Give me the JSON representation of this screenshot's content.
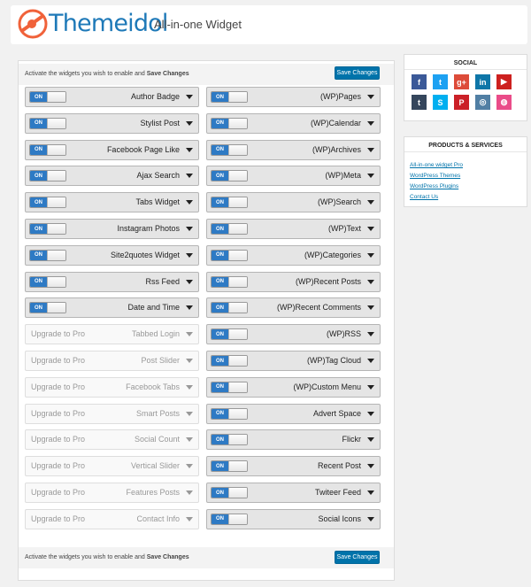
{
  "header": {
    "brand": "Themeidol",
    "subtitle": "All-in-one Widget"
  },
  "bar": {
    "instruction_prefix": "Activate the widgets you wish to enable and ",
    "instruction_bold": "Save Changes",
    "save_label": "Save Changes"
  },
  "toggle_label": "ON",
  "left_widgets": [
    {
      "label": "Author Badge",
      "active": true
    },
    {
      "label": "Stylist Post",
      "active": true
    },
    {
      "label": "Facebook Page Like",
      "active": true
    },
    {
      "label": "Ajax Search",
      "active": true
    },
    {
      "label": "Tabs Widget",
      "active": true
    },
    {
      "label": "Instagram Photos",
      "active": true
    },
    {
      "label": "Site2quotes Widget",
      "active": true
    },
    {
      "label": "Rss Feed",
      "active": true
    },
    {
      "label": "Date and Time",
      "active": true
    },
    {
      "label": "Tabbed Login",
      "active": false,
      "pro": "Upgrade to Pro"
    },
    {
      "label": "Post Slider",
      "active": false,
      "pro": "Upgrade to Pro"
    },
    {
      "label": "Facebook Tabs",
      "active": false,
      "pro": "Upgrade to Pro"
    },
    {
      "label": "Smart Posts",
      "active": false,
      "pro": "Upgrade to Pro"
    },
    {
      "label": "Social Count",
      "active": false,
      "pro": "Upgrade to Pro"
    },
    {
      "label": "Vertical Slider",
      "active": false,
      "pro": "Upgrade to Pro"
    },
    {
      "label": "Features Posts",
      "active": false,
      "pro": "Upgrade to Pro"
    },
    {
      "label": "Contact Info",
      "active": false,
      "pro": "Upgrade to Pro"
    }
  ],
  "right_widgets": [
    {
      "label": "(WP)Pages",
      "active": true
    },
    {
      "label": "(WP)Calendar",
      "active": true
    },
    {
      "label": "(WP)Archives",
      "active": true
    },
    {
      "label": "(WP)Meta",
      "active": true
    },
    {
      "label": "(WP)Search",
      "active": true
    },
    {
      "label": "(WP)Text",
      "active": true
    },
    {
      "label": "(WP)Categories",
      "active": true
    },
    {
      "label": "(WP)Recent Posts",
      "active": true
    },
    {
      "label": "(WP)Recent Comments",
      "active": true
    },
    {
      "label": "(WP)RSS",
      "active": true
    },
    {
      "label": "(WP)Tag Cloud",
      "active": true
    },
    {
      "label": "(WP)Custom Menu",
      "active": true
    },
    {
      "label": "Advert Space",
      "active": true
    },
    {
      "label": "Flickr",
      "active": true
    },
    {
      "label": "Recent Post",
      "active": true
    },
    {
      "label": "Twiteer Feed",
      "active": true
    },
    {
      "label": "Social Icons",
      "active": true
    }
  ],
  "social": {
    "title": "SOCIAL",
    "icons": [
      {
        "name": "facebook-icon",
        "glyph": "f",
        "color": "#3b5998"
      },
      {
        "name": "twitter-icon",
        "glyph": "t",
        "color": "#1da1f2"
      },
      {
        "name": "google-plus-icon",
        "glyph": "g+",
        "color": "#dd4b39"
      },
      {
        "name": "linkedin-icon",
        "glyph": "in",
        "color": "#0e76a8"
      },
      {
        "name": "youtube-icon",
        "glyph": "▶",
        "color": "#cd201f"
      },
      {
        "name": "tumblr-icon",
        "glyph": "t",
        "color": "#35465c"
      },
      {
        "name": "skype-icon",
        "glyph": "S",
        "color": "#00aff0"
      },
      {
        "name": "pinterest-icon",
        "glyph": "P",
        "color": "#cb2027"
      },
      {
        "name": "instagram-icon",
        "glyph": "◎",
        "color": "#517fa4"
      },
      {
        "name": "dribbble-icon",
        "glyph": "◍",
        "color": "#ea4c89"
      }
    ]
  },
  "products": {
    "title": "PRODUCTS & SERVICES",
    "links": [
      "All-in-one widget Pro",
      "WordPress Themes",
      "WordPress Plugins",
      "Contact Us"
    ]
  },
  "colors": {
    "accent": "#0073aa",
    "toggle_on": "#2e7ac4",
    "brand": "#1e79b8",
    "logo_orange": "#f0623a"
  }
}
